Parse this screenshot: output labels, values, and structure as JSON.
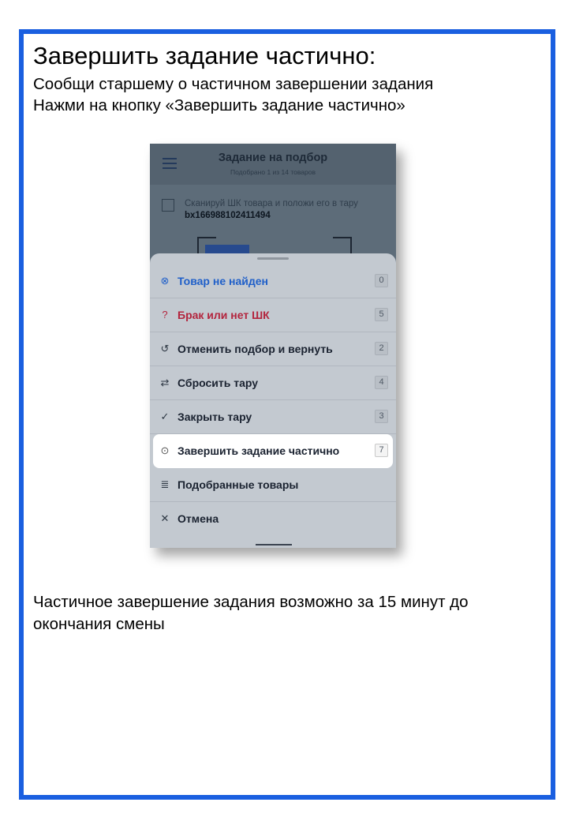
{
  "slide": {
    "title": "Завершить задание частично:",
    "line1": "Сообщи старшему о частичном завершении задания",
    "line2": "Нажми на кнопку «Завершить задание частично»",
    "footnote": "Частичное завершение задания возможно за 15 минут до окончания смены"
  },
  "phone": {
    "header_title": "Задание на подбор",
    "header_subtitle": "Подобрано 1 из 14 товаров",
    "scan_text": "Сканируй ШК товара и положи его в тару",
    "scan_code": "bx166988102411494",
    "menu": [
      {
        "icon": "not-found-icon",
        "label": "Товар не найден",
        "count": "0",
        "style": "blue"
      },
      {
        "icon": "question-icon",
        "label": "Брак или нет ШК",
        "count": "5",
        "style": "red"
      },
      {
        "icon": "undo-icon",
        "label": "Отменить подбор и вернуть",
        "count": "2",
        "style": "normal"
      },
      {
        "icon": "reset-container-icon",
        "label": "Сбросить тару",
        "count": "4",
        "style": "normal"
      },
      {
        "icon": "check-icon",
        "label": "Закрыть тару",
        "count": "3",
        "style": "normal"
      },
      {
        "icon": "check-circle-icon",
        "label": "Завершить задание частично",
        "count": "7",
        "style": "highlight"
      },
      {
        "icon": "list-icon",
        "label": "Подобранные товары",
        "count": "",
        "style": "normal"
      },
      {
        "icon": "close-icon",
        "label": "Отмена",
        "count": "",
        "style": "normal"
      }
    ]
  },
  "colors": {
    "frame_border": "#1a5fe0",
    "highlight": "#ffffff",
    "blue_item": "#1f5fc9",
    "red_item": "#b3243d"
  }
}
